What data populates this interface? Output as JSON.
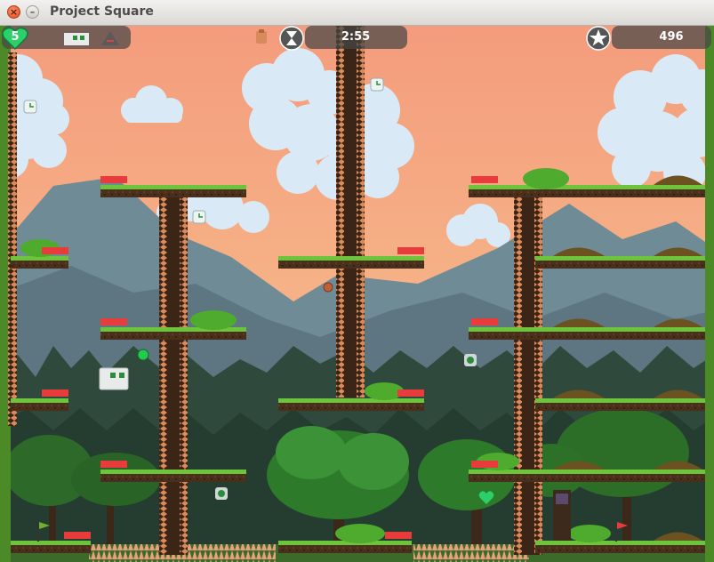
{
  "window": {
    "title": "Project Square",
    "close_glyph": "×",
    "minimize_glyph": "–"
  },
  "hud": {
    "lives": "5",
    "lives_icon": "heart-icon",
    "timer": "2:55",
    "timer_icon": "hourglass-icon",
    "score": "496",
    "score_icon": "star-icon",
    "player_icon": "player-square-icon",
    "enemy_icon": "triangle-enemy-icon"
  },
  "colors": {
    "sky": "#f2a47e",
    "grass": "#6cc43a",
    "spring": "#e83c3c",
    "heart": "#2bd06b",
    "hud_bg": "#464646"
  }
}
